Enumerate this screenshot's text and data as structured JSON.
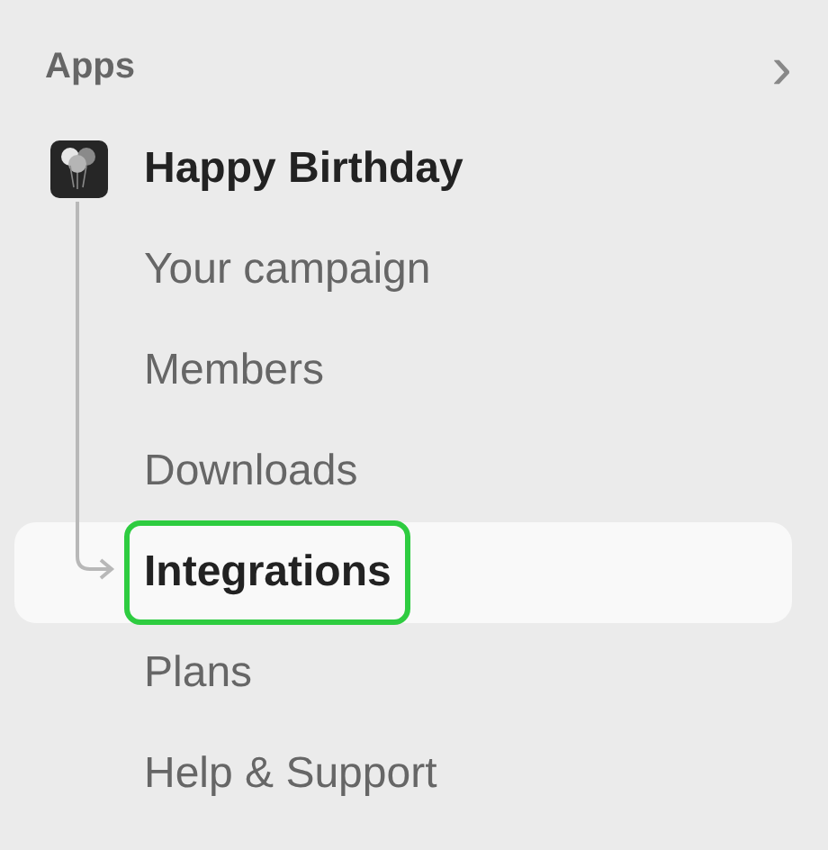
{
  "section": {
    "title": "Apps",
    "chevron": "›"
  },
  "app": {
    "name": "Happy Birthday",
    "children": [
      {
        "label": "Your campaign",
        "selected": false,
        "highlighted": false
      },
      {
        "label": "Members",
        "selected": false,
        "highlighted": false
      },
      {
        "label": "Downloads",
        "selected": false,
        "highlighted": false
      },
      {
        "label": "Integrations",
        "selected": true,
        "highlighted": true
      },
      {
        "label": "Plans",
        "selected": false,
        "highlighted": false
      },
      {
        "label": "Help & Support",
        "selected": false,
        "highlighted": false
      }
    ]
  }
}
